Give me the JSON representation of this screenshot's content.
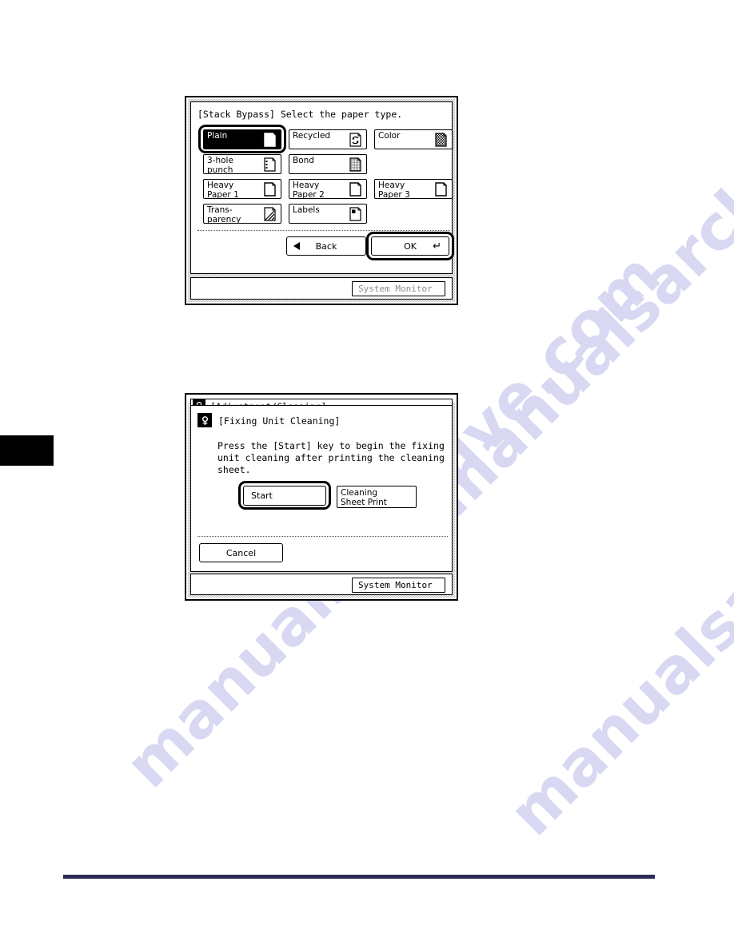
{
  "document": {
    "watermark_text": "manualsarchive.com"
  },
  "panel_paper_type": {
    "title": "[Stack Bypass] Select the paper type.",
    "paper_types": [
      {
        "label": "Plain",
        "icon": "plain-page-icon",
        "selected": true
      },
      {
        "label": "Recycled",
        "icon": "recycle-page-icon",
        "selected": false
      },
      {
        "label": "Color",
        "icon": "color-page-icon",
        "selected": false
      },
      {
        "label": "3-hole\npunch",
        "icon": "hole-punch-page-icon",
        "selected": false
      },
      {
        "label": "Bond",
        "icon": "bond-page-icon",
        "selected": false
      },
      {
        "label": "Heavy\nPaper 1",
        "icon": "plain-page-icon",
        "selected": false
      },
      {
        "label": "Heavy\nPaper 2",
        "icon": "plain-page-icon",
        "selected": false
      },
      {
        "label": "Heavy\nPaper 3",
        "icon": "plain-page-icon",
        "selected": false
      },
      {
        "label": "Trans-\nparency",
        "icon": "transparency-page-icon",
        "selected": false
      },
      {
        "label": "Labels",
        "icon": "labels-page-icon",
        "selected": false
      }
    ],
    "back_label": "Back",
    "ok_label": "OK",
    "ok_enter_glyph": "↵",
    "system_monitor_label": "System Monitor"
  },
  "panel_fixing_unit": {
    "clipped_header_label": "[Adjustment/Cleaning]",
    "title": "[Fixing Unit Cleaning]",
    "message": "Press the [Start] key to begin the fixing\nunit cleaning after printing the cleaning\nsheet.",
    "start_label": "Start",
    "cleaning_sheet_print_label": "Cleaning\nSheet Print",
    "cancel_label": "Cancel",
    "system_monitor_label": "System Monitor"
  },
  "colors": {
    "rule": "#2b2a55",
    "tab": "#000000",
    "watermark": "#d8d8f2"
  }
}
